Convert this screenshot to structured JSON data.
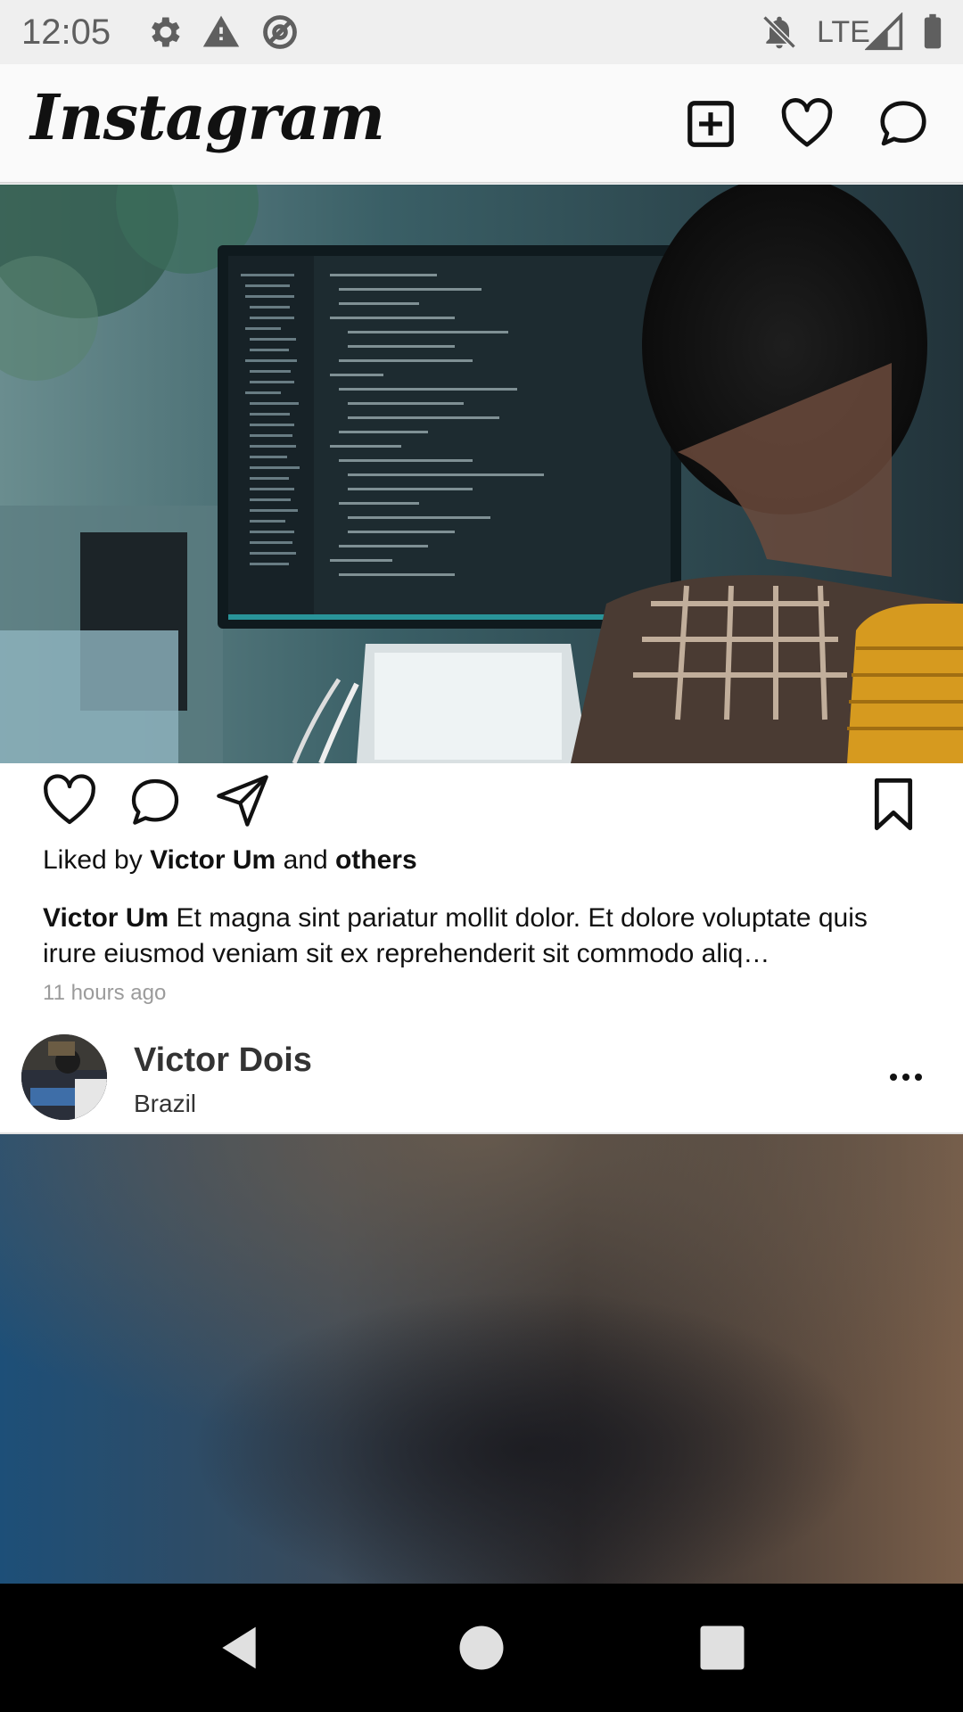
{
  "status_bar": {
    "time": "12:05",
    "network": "LTE",
    "icons": [
      "settings-icon",
      "warning-icon",
      "at-sign-icon",
      "notifications-off-icon",
      "signal-icon",
      "battery-icon"
    ]
  },
  "header": {
    "logo": "Instagram",
    "icons": [
      "add-post-icon",
      "heart-icon",
      "messenger-icon"
    ]
  },
  "post1": {
    "liked_prefix": "Liked by ",
    "liked_user": "Victor Um",
    "liked_and": " and ",
    "liked_others": "others",
    "caption_user": "Victor Um",
    "caption_text": " Et magna sint pariatur mollit dolor. Et dolore voluptate quis irure eiusmod veniam sit ex reprehenderit sit commodo aliq…",
    "time_ago": "11 hours ago",
    "actions": [
      "like-icon",
      "comment-icon",
      "share-icon",
      "bookmark-icon"
    ]
  },
  "post2": {
    "user": "Victor Dois",
    "location": "Brazil",
    "more": "..."
  },
  "nav_bar": {
    "buttons": [
      "back-icon",
      "home-icon",
      "recents-icon"
    ]
  },
  "colors": {
    "status_bar_bg": "#efefef",
    "header_bg": "#fafafa",
    "nav_bg": "#000000",
    "muted_text": "#9b9b9b"
  }
}
